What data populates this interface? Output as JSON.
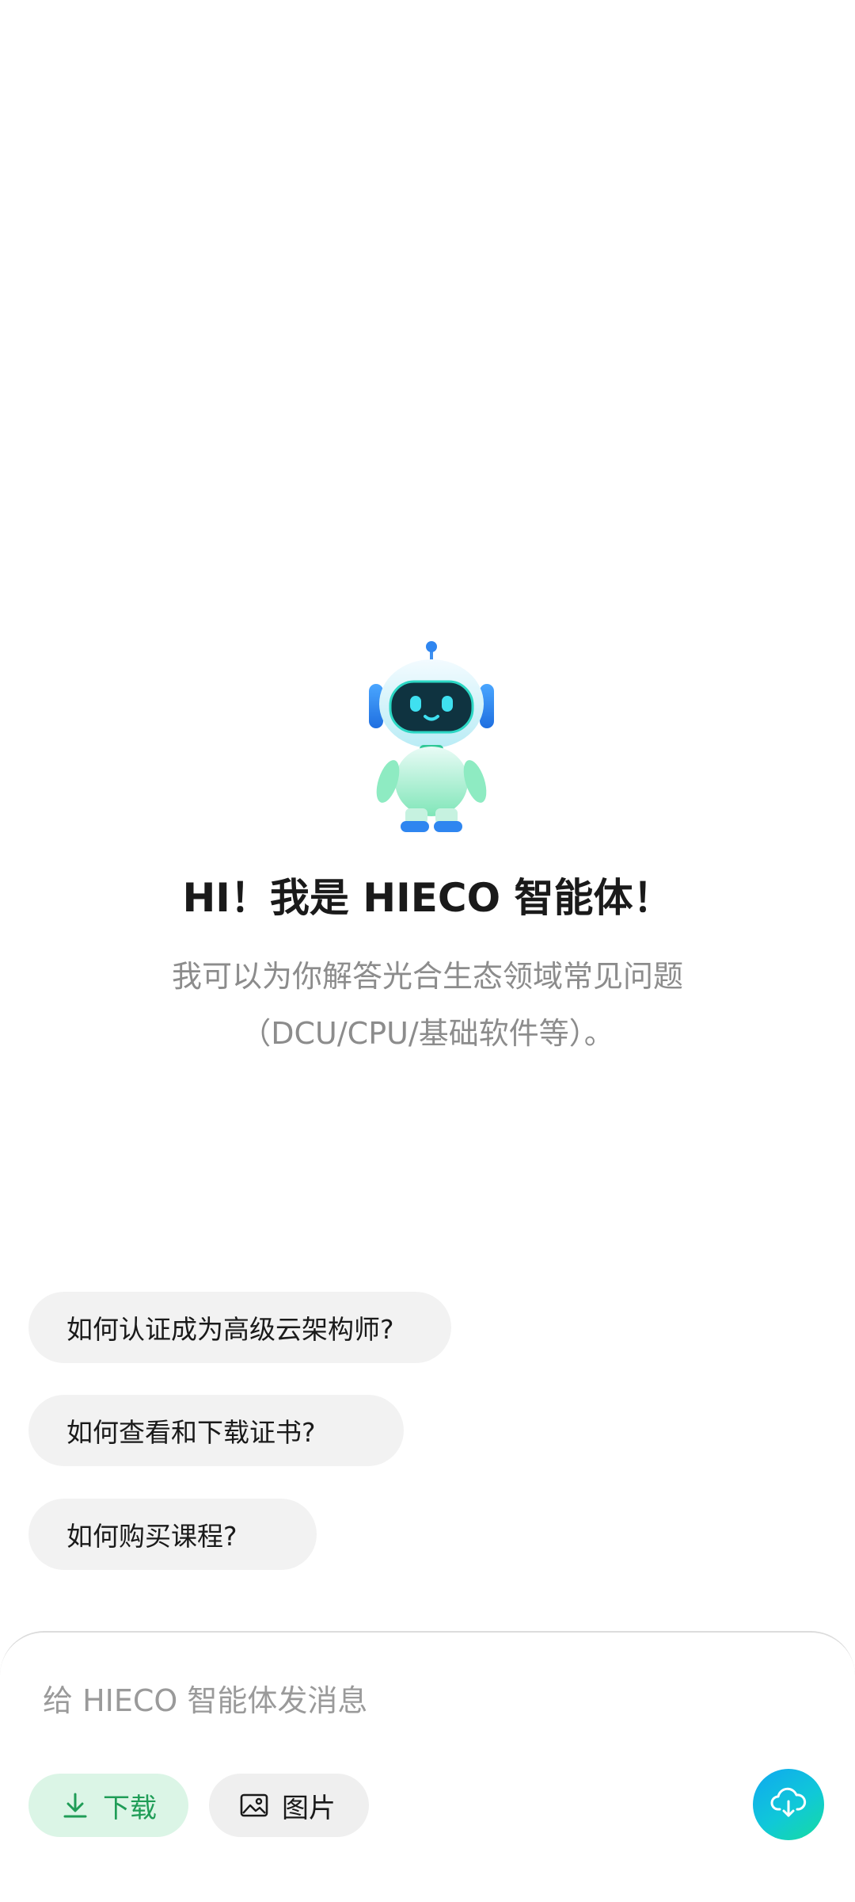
{
  "hero": {
    "title": "HI！我是 HIECO 智能体！",
    "subtitle_line1": "我可以为你解答光合生态领域常见问题",
    "subtitle_line2": "（DCU/CPU/基础软件等）。",
    "mascot_icon": "robot-mascot-icon"
  },
  "suggestions": [
    {
      "label": "如何认证成为高级云架构师?"
    },
    {
      "label": "如何查看和下载证书?"
    },
    {
      "label": "如何购买课程?"
    }
  ],
  "composer": {
    "input_value": "",
    "input_placeholder": "给 HIECO 智能体发消息",
    "download_label": "下载",
    "download_icon": "download-icon",
    "image_label": "图片",
    "image_icon": "image-icon",
    "send_icon": "cloud-download-icon"
  },
  "colors": {
    "accent_green": "#1f9d57",
    "accent_green_bg": "#dbf5e6",
    "send_gradient_start": "#0fa8f0",
    "send_gradient_end": "#16dca0"
  }
}
